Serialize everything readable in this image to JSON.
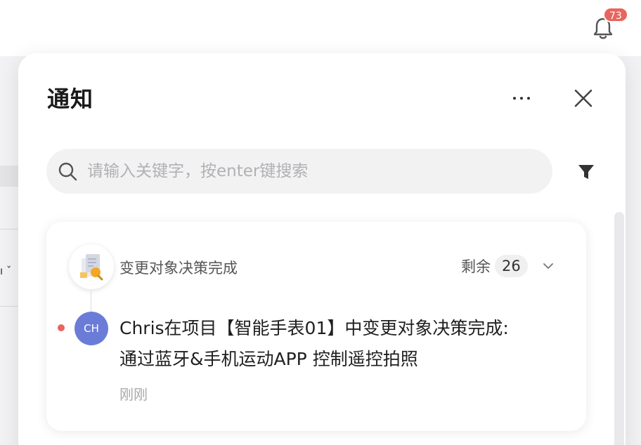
{
  "header": {
    "bell_icon": "bell-icon",
    "notification_count": "73"
  },
  "background": {
    "glyph": "ı ˇ"
  },
  "panel": {
    "title": "通知",
    "more_icon": "more-horizontal-icon",
    "close_icon": "close-icon",
    "search": {
      "placeholder": "请输入关键字，按enter键搜索",
      "value": "",
      "icon": "search-icon"
    },
    "filter_icon": "filter-icon"
  },
  "notifications": [
    {
      "category": "变更对象决策完成",
      "category_icon": "document-decision-icon",
      "remaining_label": "剩余",
      "remaining_count": "26",
      "expand_icon": "chevron-down-icon",
      "unread": true,
      "avatar_initials": "CH",
      "message_line1": "Chris在项目【智能手表01】中变更对象决策完成:",
      "message_line2": "通过蓝牙&手机运动APP 控制遥控拍照",
      "time": "刚刚"
    }
  ],
  "colors": {
    "badge": "#e8655f",
    "avatar": "#6b7cd8",
    "unread_dot": "#e8655f",
    "category_icon_accent": "#f5a623"
  }
}
